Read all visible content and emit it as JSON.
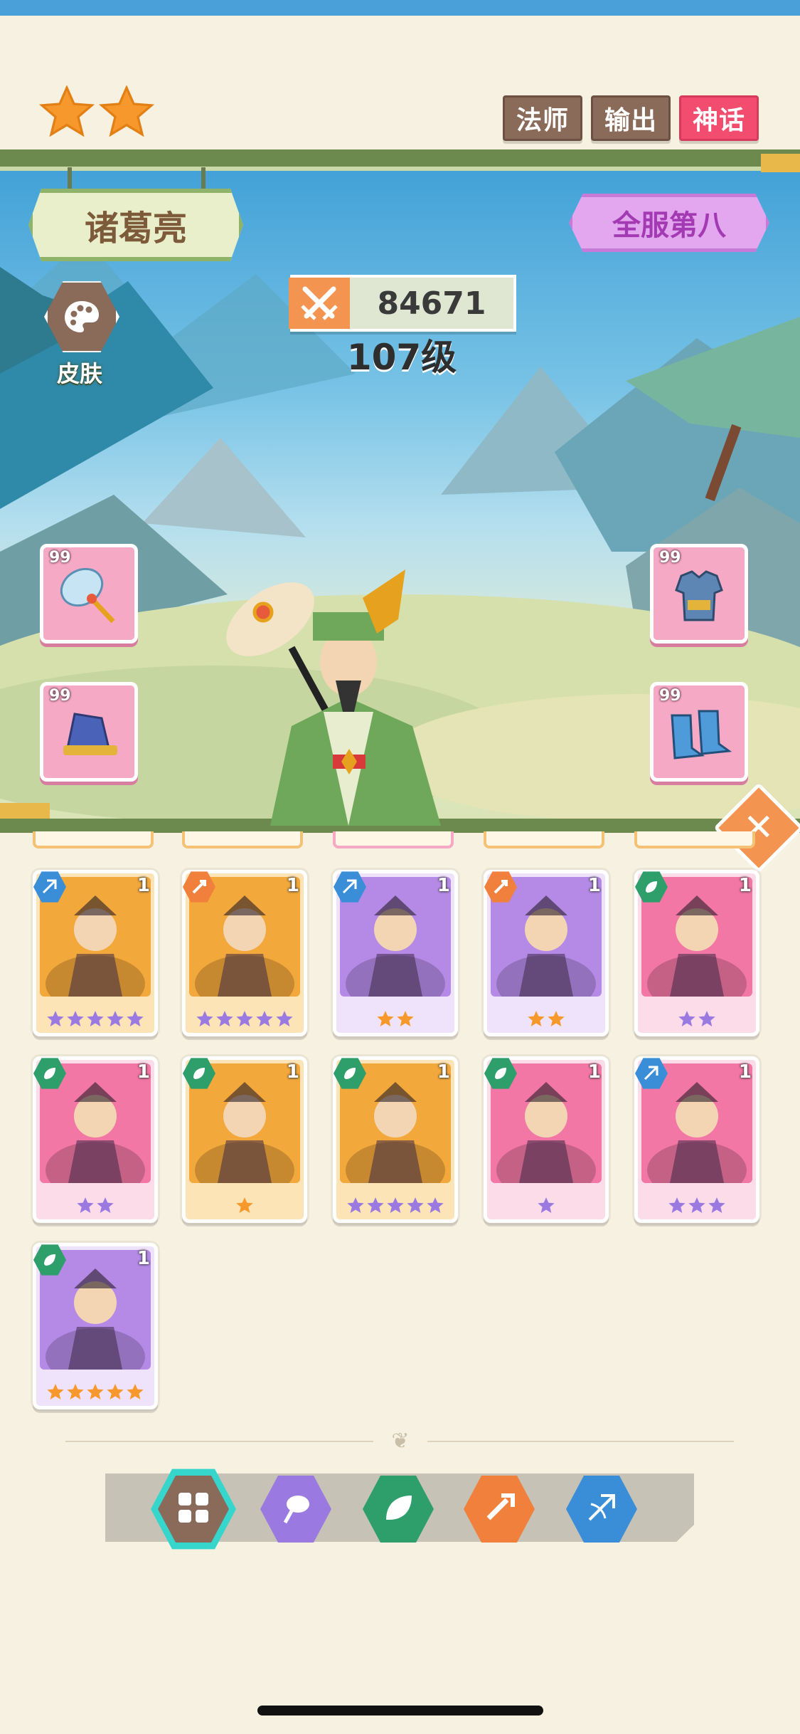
{
  "hero": {
    "name": "诸葛亮",
    "rank": "全服第八",
    "skin_label": "皮肤",
    "power": "84671",
    "level": "107级",
    "rarity_stars": 2
  },
  "tags": [
    "法师",
    "输出",
    "神话"
  ],
  "equipment": [
    {
      "slot": "weapon",
      "count": "99",
      "icon": "fan-weapon-icon"
    },
    {
      "slot": "armor",
      "count": "99",
      "icon": "armor-icon"
    },
    {
      "slot": "hat",
      "count": "99",
      "icon": "hat-icon"
    },
    {
      "slot": "boots",
      "count": "99",
      "icon": "boots-icon"
    }
  ],
  "cards": [
    {
      "level": "1",
      "frame": "orange",
      "faction": "blue",
      "star_color": "purple",
      "stars": 5
    },
    {
      "level": "1",
      "frame": "orange",
      "faction": "orange",
      "star_color": "purple",
      "stars": 5
    },
    {
      "level": "1",
      "frame": "purple",
      "faction": "blue",
      "star_color": "orange",
      "stars": 2
    },
    {
      "level": "1",
      "frame": "purple",
      "faction": "orange",
      "star_color": "orange",
      "stars": 2
    },
    {
      "level": "1",
      "frame": "pink",
      "faction": "green",
      "star_color": "purple",
      "stars": 2
    },
    {
      "level": "1",
      "frame": "pink",
      "faction": "green",
      "star_color": "purple",
      "stars": 2
    },
    {
      "level": "1",
      "frame": "orange",
      "faction": "green",
      "star_color": "orange",
      "stars": 1
    },
    {
      "level": "1",
      "frame": "orange",
      "faction": "green",
      "star_color": "purple",
      "stars": 5
    },
    {
      "level": "1",
      "frame": "pink",
      "faction": "green",
      "star_color": "purple",
      "stars": 1
    },
    {
      "level": "1",
      "frame": "pink",
      "faction": "blue",
      "star_color": "purple",
      "stars": 3
    },
    {
      "level": "1",
      "frame": "purple",
      "faction": "green",
      "star_color": "orange",
      "stars": 5
    }
  ],
  "filters": [
    {
      "name": "all",
      "color": "#8a6a59",
      "icon": "grid-icon",
      "selected": true
    },
    {
      "name": "mage",
      "color": "#9a7ae0",
      "icon": "mage-icon",
      "selected": false
    },
    {
      "name": "support",
      "color": "#2e9e6a",
      "icon": "leaf-icon",
      "selected": false
    },
    {
      "name": "warrior",
      "color": "#f0803c",
      "icon": "sword-icon",
      "selected": false
    },
    {
      "name": "archer",
      "color": "#3a8ed8",
      "icon": "bow-icon",
      "selected": false
    }
  ],
  "colors": {
    "background": "#f7f1e1",
    "orange_star": "#f7982c",
    "purple_star": "#9a7ae0",
    "tag_myth": "#f24d6f"
  }
}
